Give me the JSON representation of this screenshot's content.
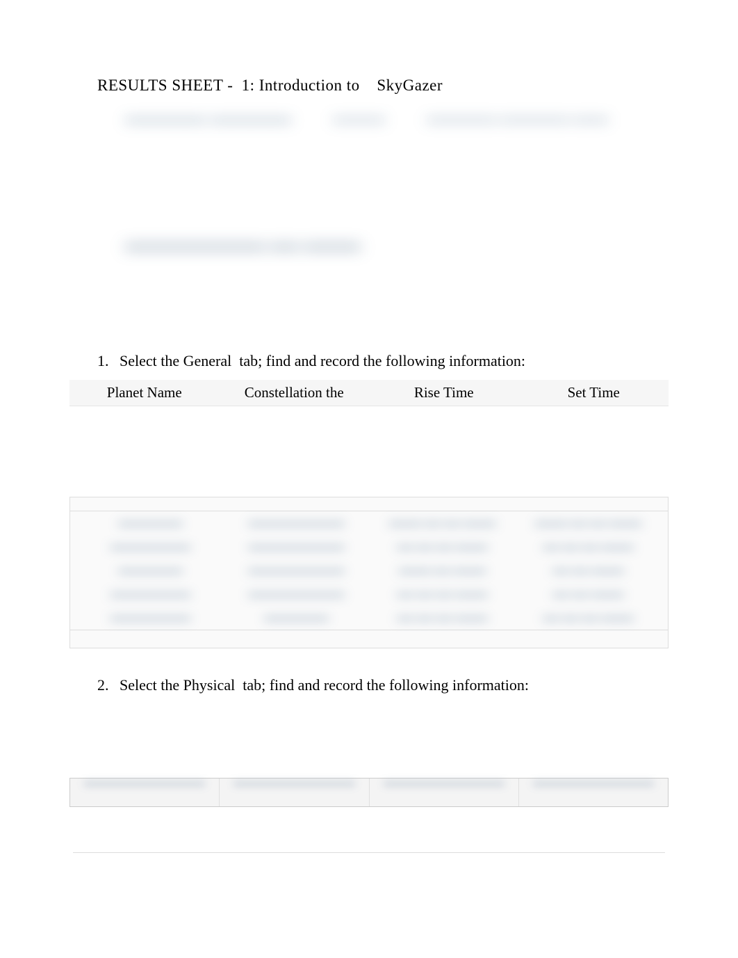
{
  "header": {
    "results_label": "RESULTS SHEET -",
    "lab_number": "1: Introduction to",
    "lab_name": "SkyGazer"
  },
  "blurred_top": {
    "item1": "———— ————",
    "item2": "———",
    "item3": "———— ———— ——"
  },
  "blurred_mid": {
    "text": "————— — ——"
  },
  "question1": {
    "number": "1.",
    "text_prefix": "Select the",
    "tab_word": "General",
    "text_suffix": "tab; find and record the following information:"
  },
  "table1": {
    "headers": {
      "col1": "Planet  Name",
      "col2": "Constellation  the",
      "col3": "Rise Time",
      "col4": "Set Time"
    },
    "rows": [
      {
        "c1": "————",
        "c2": "——————",
        "c3": "—— — — ——",
        "c4": "—— — — ——"
      },
      {
        "c1": "—————",
        "c2": "——————",
        "c3": "— — — ——",
        "c4": "— — — ——"
      },
      {
        "c1": "————",
        "c2": "——————",
        "c3": "—— — ——",
        "c4": "— — ——"
      },
      {
        "c1": "—————",
        "c2": "——————",
        "c3": "— — — ——",
        "c4": "— — ——"
      },
      {
        "c1": "—————",
        "c2": "————",
        "c3": "— — — ——",
        "c4": "— — — ——"
      }
    ]
  },
  "question2": {
    "number": "2.",
    "text_prefix": "Select the",
    "tab_word": "Physical",
    "text_suffix": "tab; find and record the following information:"
  }
}
